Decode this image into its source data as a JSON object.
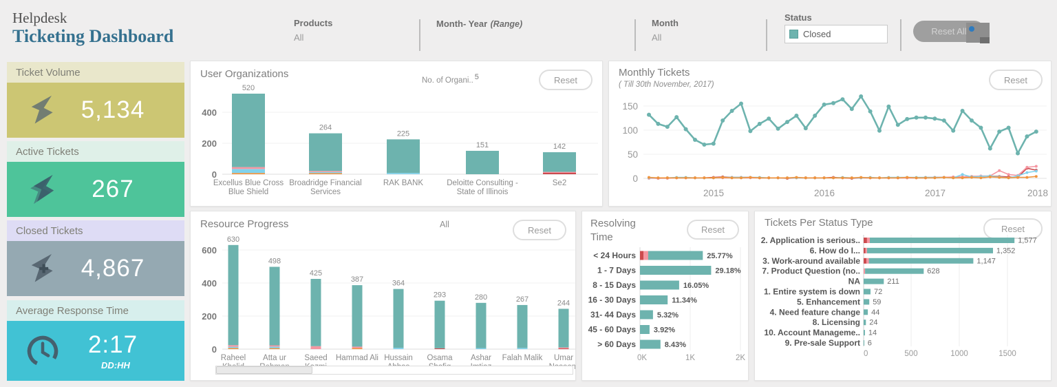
{
  "header": {
    "app_title": "Helpdesk",
    "dashboard_title": "Ticketing Dashboard",
    "filters": {
      "products": {
        "label": "Products",
        "value": "All"
      },
      "month_year": {
        "label": "Month- Year",
        "range_hint": "(Range)"
      },
      "month": {
        "label": "Month",
        "value": "All"
      },
      "status": {
        "label": "Status",
        "value": "Closed"
      }
    },
    "reset_all_label": "Reset All"
  },
  "kpis": [
    {
      "label": "Ticket Volume",
      "value": "5,134",
      "card_color": "#ccc673",
      "label_bg": "#e9e7cb",
      "icon": "ticket-icon"
    },
    {
      "label": "Active Tickets",
      "value": "267",
      "card_color": "#4ec49a",
      "label_bg": "#dff0e8",
      "icon": "ticket-layers-icon"
    },
    {
      "label": "Closed Tickets",
      "value": "4,867",
      "card_color": "#95a9b2",
      "label_bg": "#dedcf5",
      "icon": "ticket-plus-icon"
    },
    {
      "label": "Average Response Time",
      "value": "2:17",
      "unit": "DD:HH",
      "card_color": "#41c2d4",
      "label_bg": "#d7efed",
      "icon": "clock-icon"
    }
  ],
  "colors": {
    "teal": "#6db3ae",
    "orange": "#f0943d",
    "sky": "#82d2ec",
    "red": "#cc4a4e",
    "pink": "#f596a1"
  },
  "charts": {
    "user_organizations": {
      "title": "User Organizations",
      "info_label": "No. of Organi..",
      "info_value": "5",
      "reset_label": "Reset",
      "y_ticks": [
        400,
        200,
        0
      ],
      "bars": [
        {
          "lines": [
            "Excellus Blue Cross",
            "Blue Shield"
          ],
          "total": 520,
          "segments": [
            {
              "color": "orange",
              "value": 8
            },
            {
              "color": "sky",
              "value": 26
            },
            {
              "color": "pink",
              "value": 12
            },
            {
              "color": "teal",
              "value": 474
            }
          ]
        },
        {
          "lines": [
            "Broadridge Financial",
            "Services"
          ],
          "total": 264,
          "segments": [
            {
              "color": "orange",
              "value": 7
            },
            {
              "color": "sky",
              "value": 7
            },
            {
              "color": "pink",
              "value": 7
            },
            {
              "color": "teal",
              "value": 243
            }
          ]
        },
        {
          "lines": [
            "RAK BANK"
          ],
          "total": 225,
          "segments": [
            {
              "color": "sky",
              "value": 8
            },
            {
              "color": "teal",
              "value": 217
            }
          ]
        },
        {
          "lines": [
            "Deloitte Consulting -",
            "State of Illinois"
          ],
          "total": 151,
          "segments": [
            {
              "color": "teal",
              "value": 151
            }
          ]
        },
        {
          "lines": [
            "Se2"
          ],
          "total": 142,
          "segments": [
            {
              "color": "red",
              "value": 9
            },
            {
              "color": "pink",
              "value": 6
            },
            {
              "color": "teal",
              "value": 127
            }
          ]
        }
      ]
    },
    "monthly_tickets": {
      "title": "Monthly Tickets",
      "subtitle": "( Till 30th November, 2017)",
      "reset_label": "Reset",
      "y_ticks": [
        150,
        100,
        50,
        0
      ],
      "x_ticks": [
        "2015",
        "2016",
        "2017",
        "2018"
      ],
      "series": [
        {
          "name": "red-series",
          "color": "red",
          "values": [
            1,
            0,
            1,
            1,
            1,
            1,
            1,
            2,
            3,
            2,
            2,
            2,
            1,
            1,
            1,
            0,
            1,
            1,
            1,
            1,
            2,
            1,
            0,
            1,
            1,
            1,
            1,
            1,
            1,
            1,
            1,
            2,
            2,
            2,
            3,
            4,
            4,
            5,
            4,
            3,
            2,
            21,
            17
          ]
        },
        {
          "name": "pink-series",
          "color": "pink",
          "values": [
            0,
            0,
            0,
            1,
            1,
            1,
            1,
            1,
            1,
            1,
            1,
            1,
            1,
            1,
            1,
            1,
            1,
            1,
            1,
            1,
            1,
            1,
            1,
            1,
            1,
            1,
            1,
            1,
            1,
            1,
            2,
            2,
            2,
            3,
            3,
            4,
            5,
            5,
            16,
            8,
            6,
            23,
            25
          ]
        },
        {
          "name": "sky-series",
          "color": "sky",
          "values": [
            1,
            1,
            1,
            2,
            2,
            1,
            1,
            1,
            2,
            2,
            2,
            2,
            2,
            1,
            1,
            1,
            1,
            1,
            1,
            1,
            1,
            2,
            1,
            1,
            2,
            1,
            2,
            2,
            2,
            2,
            2,
            2,
            2,
            1,
            8,
            3,
            4,
            5,
            3,
            1,
            5,
            12,
            15
          ]
        },
        {
          "name": "orange-series",
          "color": "orange",
          "values": [
            2,
            1,
            1,
            1,
            1,
            1,
            1,
            1,
            2,
            1,
            1,
            2,
            1,
            1,
            1,
            1,
            2,
            1,
            1,
            1,
            1,
            1,
            1,
            2,
            1,
            1,
            1,
            1,
            2,
            1,
            1,
            1,
            2,
            1,
            1,
            2,
            1,
            3,
            2,
            1,
            2,
            2,
            4
          ]
        },
        {
          "name": "teal-series",
          "color": "teal",
          "values": [
            132,
            113,
            107,
            127,
            102,
            80,
            70,
            72,
            120,
            140,
            155,
            98,
            113,
            124,
            103,
            117,
            130,
            104,
            130,
            153,
            156,
            164,
            144,
            170,
            139,
            99,
            149,
            111,
            123,
            126,
            126,
            124,
            120,
            99,
            140,
            120,
            105,
            62,
            97,
            105,
            52,
            87,
            97
          ]
        }
      ]
    },
    "resource_progress": {
      "title": "Resource Progress",
      "filter_label": "All",
      "reset_label": "Reset",
      "y_ticks": [
        600,
        400,
        200,
        0
      ],
      "bars": [
        {
          "lines": [
            "Raheel",
            "Khalid"
          ],
          "total": 630,
          "segments": [
            {
              "color": "orange",
              "value": 7
            },
            {
              "color": "sky",
              "value": 7
            },
            {
              "color": "pink",
              "value": 10
            },
            {
              "color": "teal",
              "value": 606
            }
          ]
        },
        {
          "lines": [
            "Atta ur",
            "Rehman"
          ],
          "total": 498,
          "segments": [
            {
              "color": "orange",
              "value": 6
            },
            {
              "color": "sky",
              "value": 9
            },
            {
              "color": "pink",
              "value": 8
            },
            {
              "color": "teal",
              "value": 475
            }
          ]
        },
        {
          "lines": [
            "Saeed",
            "Kazmi"
          ],
          "total": 425,
          "segments": [
            {
              "color": "pink",
              "value": 18
            },
            {
              "color": "teal",
              "value": 407
            }
          ]
        },
        {
          "lines": [
            "Hammad Ali"
          ],
          "total": 387,
          "segments": [
            {
              "color": "orange",
              "value": 6
            },
            {
              "color": "pink",
              "value": 9
            },
            {
              "color": "teal",
              "value": 372
            }
          ]
        },
        {
          "lines": [
            "Hussain",
            "Abbas"
          ],
          "total": 364,
          "segments": [
            {
              "color": "sky",
              "value": 8
            },
            {
              "color": "teal",
              "value": 356
            }
          ]
        },
        {
          "lines": [
            "Osama",
            "Shafiq"
          ],
          "total": 293,
          "segments": [
            {
              "color": "red",
              "value": 5
            },
            {
              "color": "teal",
              "value": 288
            }
          ]
        },
        {
          "lines": [
            "Ashar",
            "Imtiaz"
          ],
          "total": 280,
          "segments": [
            {
              "color": "sky",
              "value": 6
            },
            {
              "color": "teal",
              "value": 274
            }
          ]
        },
        {
          "lines": [
            "Falah Malik"
          ],
          "total": 267,
          "segments": [
            {
              "color": "sky",
              "value": 7
            },
            {
              "color": "teal",
              "value": 260
            }
          ]
        },
        {
          "lines": [
            "Umar",
            "Naseem"
          ],
          "total": 244,
          "segments": [
            {
              "color": "red",
              "value": 4
            },
            {
              "color": "pink",
              "value": 6
            },
            {
              "color": "teal",
              "value": 234
            }
          ]
        }
      ]
    },
    "resolving_time": {
      "title": "Resolving Time",
      "reset_label": "Reset",
      "x_ticks": [
        "0K",
        "1K",
        "2K"
      ],
      "rows": [
        {
          "label": "< 24 Hours",
          "pct": "25.77%",
          "segments": [
            {
              "color": "red",
              "value": 68
            },
            {
              "color": "pink",
              "value": 96
            },
            {
              "color": "teal",
              "value": 1090
            }
          ]
        },
        {
          "label": "1 - 7 Days",
          "pct": "29.18%",
          "segments": [
            {
              "color": "teal",
              "value": 1420
            }
          ]
        },
        {
          "label": "8 - 15 Days",
          "pct": "16.05%",
          "segments": [
            {
              "color": "teal",
              "value": 781
            }
          ]
        },
        {
          "label": "16 - 30 Days",
          "pct": "11.34%",
          "segments": [
            {
              "color": "teal",
              "value": 552
            }
          ]
        },
        {
          "label": "31- 44 Days",
          "pct": "5.32%",
          "segments": [
            {
              "color": "teal",
              "value": 259
            }
          ]
        },
        {
          "label": "45 - 60 Days",
          "pct": "3.92%",
          "segments": [
            {
              "color": "teal",
              "value": 191
            }
          ]
        },
        {
          "label": "> 60 Days",
          "pct": "8.43%",
          "segments": [
            {
              "color": "teal",
              "value": 410
            }
          ]
        }
      ]
    },
    "tickets_per_status": {
      "title": "Tickets Per Status Type",
      "reset_label": "Reset",
      "x_ticks": [
        "0",
        "500",
        "1000",
        "1500"
      ],
      "rows": [
        {
          "label": "2. Application is serious..",
          "value_label": "1,577",
          "segments": [
            {
              "color": "red",
              "value": 35
            },
            {
              "color": "pink",
              "value": 30
            },
            {
              "color": "teal",
              "value": 1512
            }
          ]
        },
        {
          "label": "6. How do I...",
          "value_label": "1,352",
          "segments": [
            {
              "color": "red",
              "value": 20
            },
            {
              "color": "pink",
              "value": 15
            },
            {
              "color": "teal",
              "value": 1317
            }
          ]
        },
        {
          "label": "3. Work-around available",
          "value_label": "1,147",
          "segments": [
            {
              "color": "red",
              "value": 30
            },
            {
              "color": "pink",
              "value": 25
            },
            {
              "color": "teal",
              "value": 1092
            }
          ]
        },
        {
          "label": "7. Product Question (no..",
          "value_label": "628",
          "segments": [
            {
              "color": "pink",
              "value": 15
            },
            {
              "color": "teal",
              "value": 613
            }
          ]
        },
        {
          "label": "NA",
          "value_label": "211",
          "segments": [
            {
              "color": "teal",
              "value": 211
            }
          ]
        },
        {
          "label": "1. Entire system is down",
          "value_label": "72",
          "segments": [
            {
              "color": "teal",
              "value": 72
            }
          ]
        },
        {
          "label": "5. Enhancement",
          "value_label": "59",
          "segments": [
            {
              "color": "teal",
              "value": 59
            }
          ]
        },
        {
          "label": "4. Need feature change",
          "value_label": "44",
          "segments": [
            {
              "color": "teal",
              "value": 44
            }
          ]
        },
        {
          "label": "8. Licensing",
          "value_label": "24",
          "segments": [
            {
              "color": "teal",
              "value": 24
            }
          ]
        },
        {
          "label": "10. Account Manageme..",
          "value_label": "14",
          "segments": [
            {
              "color": "teal",
              "value": 14
            }
          ]
        },
        {
          "label": "9. Pre-sale Support",
          "value_label": "6",
          "segments": [
            {
              "color": "teal",
              "value": 6
            }
          ]
        }
      ]
    }
  }
}
